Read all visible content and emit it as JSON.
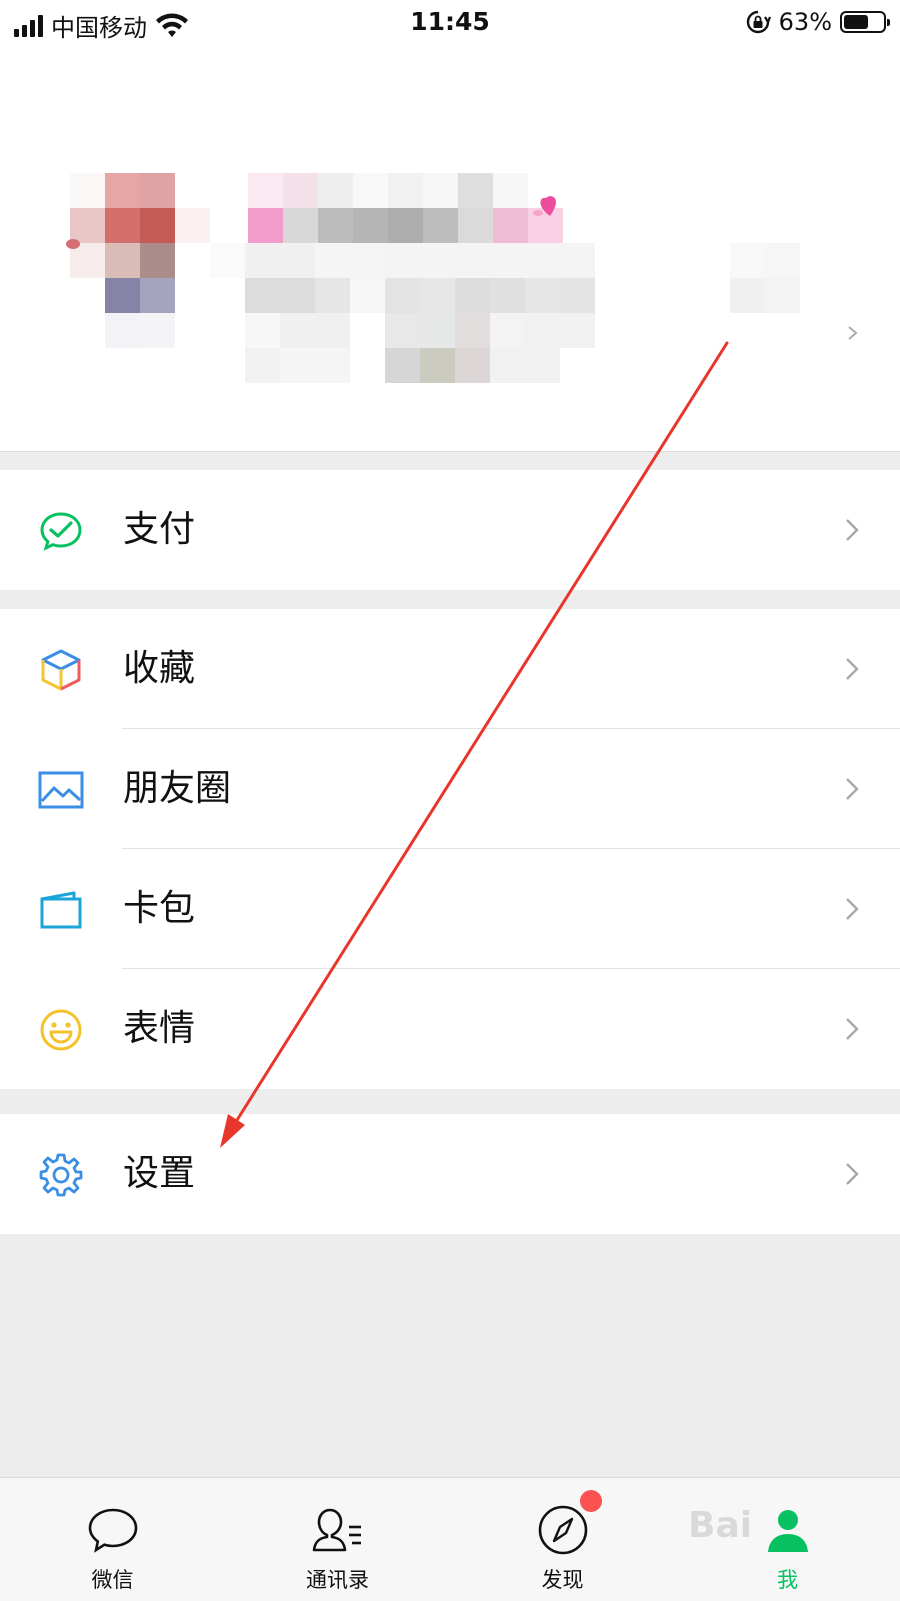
{
  "status": {
    "carrier": "中国移动",
    "time": "11:45",
    "battery": "63%",
    "battery_level": 0.63
  },
  "menu": {
    "pay": "支付",
    "favorites": "收藏",
    "moments": "朋友圈",
    "cards": "卡包",
    "stickers": "表情",
    "settings": "设置"
  },
  "icons": {
    "pay": "wechat-pay-icon",
    "favorites": "cube-icon",
    "moments": "picture-icon",
    "cards": "card-icon",
    "stickers": "smile-icon",
    "settings": "gear-icon"
  },
  "tabs": [
    {
      "label": "微信",
      "icon": "chat-bubble-icon"
    },
    {
      "label": "通讯录",
      "icon": "contacts-icon"
    },
    {
      "label": "发现",
      "icon": "compass-icon"
    },
    {
      "label": "我",
      "icon": "me-icon"
    }
  ],
  "colors": {
    "accent": "#07c160",
    "badge": "#fa5151",
    "arrow": "#e8362c"
  }
}
